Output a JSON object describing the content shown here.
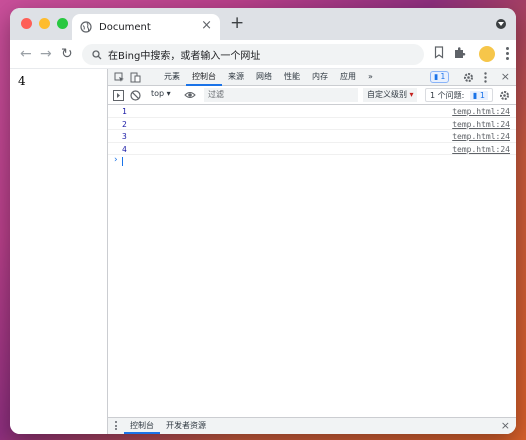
{
  "tab": {
    "title": "Document",
    "close": "×"
  },
  "toolbar": {
    "new_tab": "+",
    "back": "←",
    "forward": "→",
    "reload": "↻"
  },
  "omnibox": {
    "text": "在Bing中搜索，或者输入一个网址"
  },
  "page": {
    "text": "4"
  },
  "devtools": {
    "tabs": [
      {
        "label": "元素"
      },
      {
        "label": "控制台",
        "active": true
      },
      {
        "label": "来源"
      },
      {
        "label": "网络"
      },
      {
        "label": "性能"
      },
      {
        "label": "内存"
      },
      {
        "label": "应用"
      },
      {
        "label": "»"
      }
    ],
    "badge_count": "1",
    "close": "×",
    "context": "top",
    "filter_placeholder": "过滤",
    "levels": "自定义级别",
    "issues_label": "1 个问题:",
    "issues_count": "1",
    "logs": [
      {
        "value": "1",
        "source": "temp.html:24"
      },
      {
        "value": "2",
        "source": "temp.html:24"
      },
      {
        "value": "3",
        "source": "temp.html:24"
      },
      {
        "value": "4",
        "source": "temp.html:24"
      }
    ],
    "prompt": "›"
  },
  "drawer": {
    "tabs": [
      {
        "label": "控制台",
        "active": true
      },
      {
        "label": "开发者资源"
      }
    ],
    "close": "×"
  },
  "colors": {
    "accent": "#1a73e8",
    "tab_bar": "#dee1e6",
    "avatar": "#f6c64a"
  }
}
